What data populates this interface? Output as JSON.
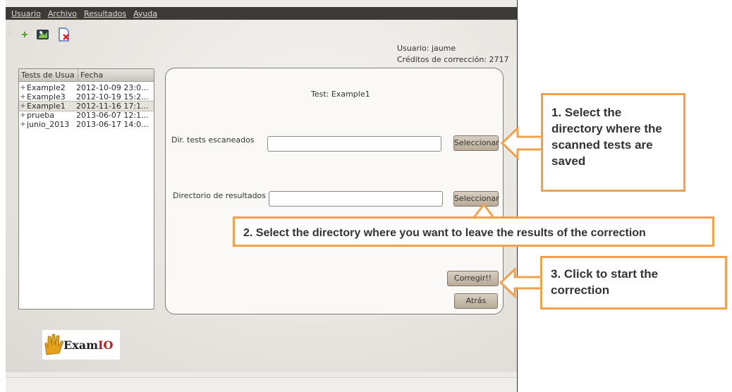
{
  "menu": [
    "Usuario",
    "Archivo",
    "Resultados",
    "Ayuda"
  ],
  "toolbar": {
    "icons": [
      "add-icon",
      "import-icon",
      "delete-document-icon"
    ]
  },
  "user": {
    "name_line": "Usuario: jaume",
    "credits_line": "Créditos de corrección: 2717"
  },
  "tests_list": {
    "columns": [
      "Tests de Usua",
      "Fecha"
    ],
    "rows": [
      {
        "name": "Example2",
        "date": "2012-10-09 23:0..."
      },
      {
        "name": "Example3",
        "date": "2012-10-19 15:2..."
      },
      {
        "name": "Example1",
        "date": "2012-11-16 17:1...",
        "selected": true
      },
      {
        "name": "prueba",
        "date": "2013-06-07 12:1..."
      },
      {
        "name": "junio_2013",
        "date": "2013-06-17 14:0..."
      }
    ]
  },
  "panel": {
    "test_title": "Test: Example1",
    "scanned_label": "Dir. tests escaneados",
    "scanned_value": "",
    "scanned_button": "Seleccionar",
    "results_label": "Directorio de resultados",
    "results_value": "",
    "results_button": "Seleccionar",
    "correct_button": "Corregir!!",
    "back_button": "Atrás"
  },
  "logo": {
    "text_main": "Exam",
    "text_accent": "IO"
  },
  "annotations": {
    "callout1": "1. Select the directory where the scanned tests are saved",
    "callout2": "2. Select the directory where you want to leave the results of the correction",
    "callout3": "3. Click to start the correction"
  },
  "colors": {
    "menubar": "#3c3b37",
    "callout_border": "#f0a14d",
    "button": "#c9bca8"
  }
}
